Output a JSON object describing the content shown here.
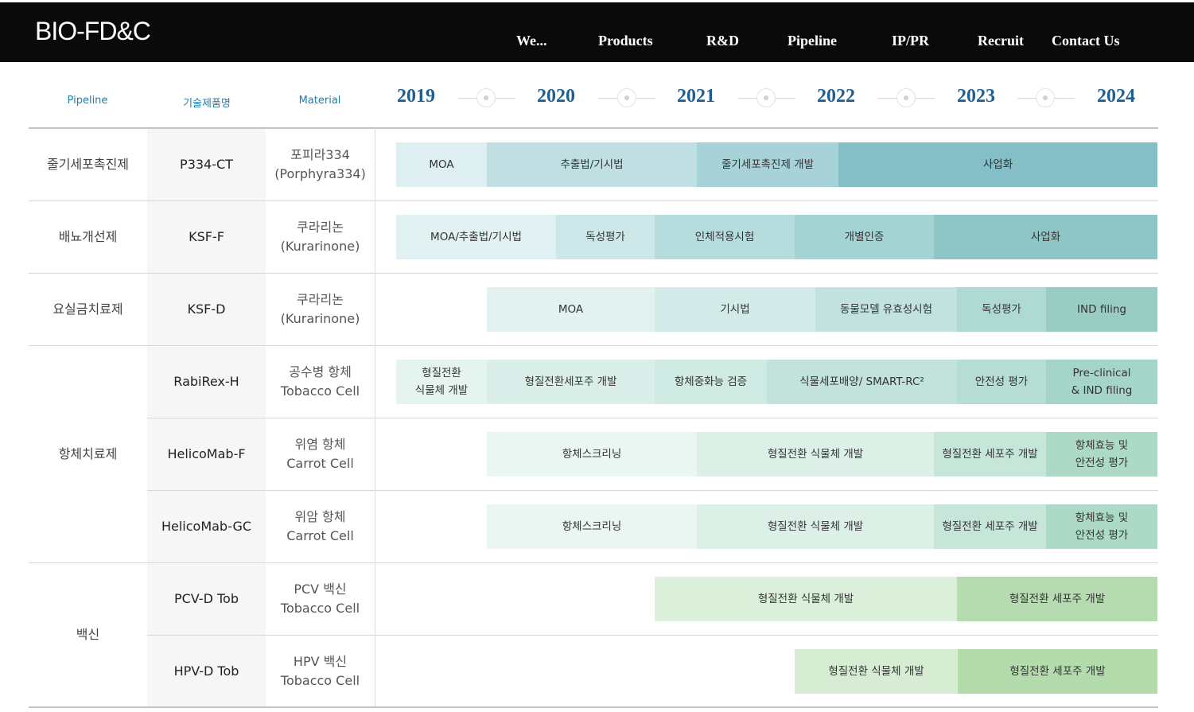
{
  "header": {
    "logo": "BIO-FD&C",
    "nav": [
      "We...",
      "Products",
      "R&D",
      "Pipeline",
      "IP/PR",
      "Recruit",
      "Contact Us"
    ]
  },
  "table": {
    "columns": {
      "pipeline": "Pipeline",
      "product": "기술제품명",
      "material": "Material"
    },
    "years": [
      "2019",
      "2020",
      "2021",
      "2022",
      "2023",
      "2024"
    ],
    "categories": [
      "줄기세포촉진제",
      "배뇨개선제",
      "요실금치료제",
      "항체치료제",
      "백신"
    ],
    "rows": [
      {
        "product": "P334-CT",
        "material": [
          "포피라334",
          "(Porphyra334)"
        ],
        "stages": [
          "MOA",
          "추출법/기시법",
          "줄기세포촉진제 개발",
          "사업화"
        ]
      },
      {
        "product": "KSF-F",
        "material": [
          "쿠라리논",
          "(Kurarinone)"
        ],
        "stages": [
          "MOA/추출법/기시법",
          "독성평가",
          "인체적용시험",
          "개별인증",
          "사업화"
        ]
      },
      {
        "product": "KSF-D",
        "material": [
          "쿠라리논",
          "(Kurarinone)"
        ],
        "stages": [
          "MOA",
          "기시법",
          "동물모델 유효성시험",
          "독성평가",
          "IND filing"
        ]
      },
      {
        "product": "RabiRex-H",
        "material": [
          "공수병 항체",
          "Tobacco Cell"
        ],
        "stages": [
          "형질전환\n식물체 개발",
          "형질전환세포주 개발",
          "항체중화능 검증",
          "식물세포배양/ SMART-RC²",
          "안전성 평가",
          "Pre-clinical\n& IND filing"
        ]
      },
      {
        "product": "HelicoMab-F",
        "material": [
          "위염 항체",
          "Carrot Cell"
        ],
        "stages": [
          "항체스크리닝",
          "형질전환 식물체 개발",
          "형질전환 세포주 개발",
          "항체효능 및\n안전성 평가"
        ]
      },
      {
        "product": "HelicoMab-GC",
        "material": [
          "위암 항체",
          "Carrot Cell"
        ],
        "stages": [
          "항체스크리닝",
          "형질전환 식물체 개발",
          "형질전환 세포주 개발",
          "항체효능 및\n안전성 평가"
        ]
      },
      {
        "product": "PCV-D Tob",
        "material": [
          "PCV 백신",
          "Tobacco Cell"
        ],
        "stages": [
          "형질전환 식물체 개발",
          "형질전환 세포주 개발"
        ]
      },
      {
        "product": "HPV-D Tob",
        "material": [
          "HPV 백신",
          "Tobacco Cell"
        ],
        "stages": [
          "형질전환 식물체 개발",
          "형질전환 세포주 개발"
        ]
      }
    ]
  },
  "colors": {
    "header_bg": "#0a0a0a",
    "year_text": "#1f5f8f",
    "column_head_text": "#1d7fb0",
    "product_cell_bg": "#f6f6f6"
  }
}
